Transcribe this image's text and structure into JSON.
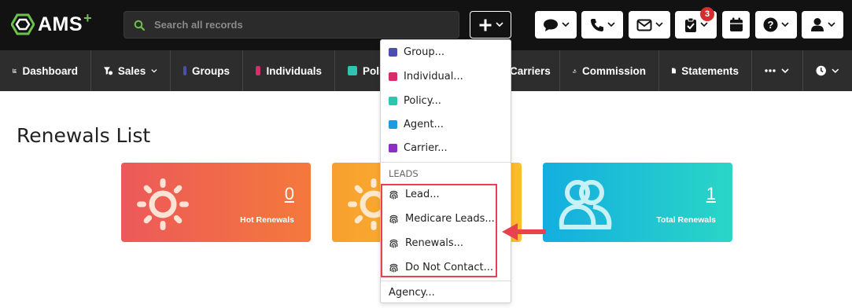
{
  "brand": {
    "logo_text": "AMS",
    "logo_plus": "+"
  },
  "search": {
    "placeholder": "Search all records"
  },
  "topbar": {
    "notification_count": "3"
  },
  "nav": {
    "items": [
      {
        "label": "Dashboard"
      },
      {
        "label": "Sales"
      },
      {
        "label": "Groups"
      },
      {
        "label": "Individuals"
      },
      {
        "label": "Poli"
      },
      {
        "label": "Carriers"
      },
      {
        "label": "Commission"
      },
      {
        "label": "Statements"
      }
    ]
  },
  "page": {
    "title": "Renewals List"
  },
  "cards": [
    {
      "value": "0",
      "label": "Hot Renewals"
    },
    {
      "value": "1",
      "label": "Total Renewals"
    }
  ],
  "dropdown": {
    "items": [
      {
        "label": "Group..."
      },
      {
        "label": "Individual..."
      },
      {
        "label": "Policy..."
      },
      {
        "label": "Agent..."
      },
      {
        "label": "Carrier..."
      }
    ],
    "leads_header": "LEADS",
    "leads": [
      {
        "label": "Lead..."
      },
      {
        "label": "Medicare Leads..."
      },
      {
        "label": "Renewals..."
      },
      {
        "label": "Do Not Contact..."
      }
    ],
    "footer_item": "Agency..."
  },
  "colors": {
    "groups": "#4a4fb0",
    "individuals": "#d62d6b",
    "policy": "#2ec4b0",
    "agent": "#1f9ae0",
    "carrier": "#8e2cc4",
    "highlight": "#e8424e"
  }
}
